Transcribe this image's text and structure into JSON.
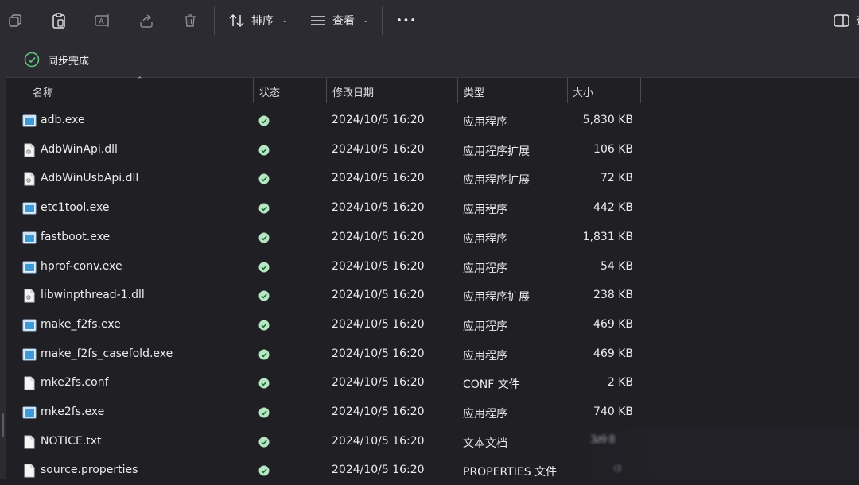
{
  "toolbar": {
    "sort_label": "排序",
    "view_label": "查看",
    "more_label": "•••",
    "right_icon_partial": "查"
  },
  "status": {
    "sync_text": "同步完成"
  },
  "columns": {
    "name": "名称",
    "status": "状态",
    "modified": "修改日期",
    "type": "类型",
    "size": "大小"
  },
  "files": [
    {
      "name": "adb.exe",
      "date": "2024/10/5 16:20",
      "type": "应用程序",
      "size": "5,830 KB",
      "icon": "exe-icon"
    },
    {
      "name": "AdbWinApi.dll",
      "date": "2024/10/5 16:20",
      "type": "应用程序扩展",
      "size": "106 KB",
      "icon": "dll-icon"
    },
    {
      "name": "AdbWinUsbApi.dll",
      "date": "2024/10/5 16:20",
      "type": "应用程序扩展",
      "size": "72 KB",
      "icon": "dll-icon"
    },
    {
      "name": "etc1tool.exe",
      "date": "2024/10/5 16:20",
      "type": "应用程序",
      "size": "442 KB",
      "icon": "exe-icon"
    },
    {
      "name": "fastboot.exe",
      "date": "2024/10/5 16:20",
      "type": "应用程序",
      "size": "1,831 KB",
      "icon": "exe-icon"
    },
    {
      "name": "hprof-conv.exe",
      "date": "2024/10/5 16:20",
      "type": "应用程序",
      "size": "54 KB",
      "icon": "exe-icon"
    },
    {
      "name": "libwinpthread-1.dll",
      "date": "2024/10/5 16:20",
      "type": "应用程序扩展",
      "size": "238 KB",
      "icon": "dll-icon"
    },
    {
      "name": "make_f2fs.exe",
      "date": "2024/10/5 16:20",
      "type": "应用程序",
      "size": "469 KB",
      "icon": "exe-icon"
    },
    {
      "name": "make_f2fs_casefold.exe",
      "date": "2024/10/5 16:20",
      "type": "应用程序",
      "size": "469 KB",
      "icon": "exe-icon"
    },
    {
      "name": "mke2fs.conf",
      "date": "2024/10/5 16:20",
      "type": "CONF 文件",
      "size": "2 KB",
      "icon": "file-icon"
    },
    {
      "name": "mke2fs.exe",
      "date": "2024/10/5 16:20",
      "type": "应用程序",
      "size": "740 KB",
      "icon": "exe-icon"
    },
    {
      "name": "NOTICE.txt",
      "date": "2024/10/5 16:20",
      "type": "文本文档",
      "size": "",
      "icon": "file-icon"
    },
    {
      "name": "source.properties",
      "date": "2024/10/5 16:20",
      "type": "PROPERTIES 文件",
      "size": "",
      "icon": "file-icon"
    }
  ],
  "colors": {
    "background": "#1f1f24",
    "toolbar": "#2b2b31",
    "accent_green": "#5fc27a",
    "exe_blue": "#3a9bd8"
  }
}
